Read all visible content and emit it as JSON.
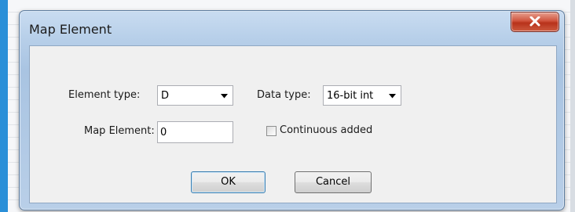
{
  "dialog": {
    "title": "Map Element"
  },
  "form": {
    "element_type_label": "Element type:",
    "element_type_value": "D",
    "data_type_label": "Data type:",
    "data_type_value": "16-bit int",
    "map_element_label": "Map Element:",
    "map_element_value": "0",
    "continuous_label": "Continuous added",
    "continuous_checked": false
  },
  "buttons": {
    "ok": "OK",
    "cancel": "Cancel"
  },
  "icons": {
    "close": "close-icon",
    "dropdown": "chevron-down-icon"
  },
  "colors": {
    "accent": "#2a8fd8",
    "close_red": "#c9452b"
  }
}
